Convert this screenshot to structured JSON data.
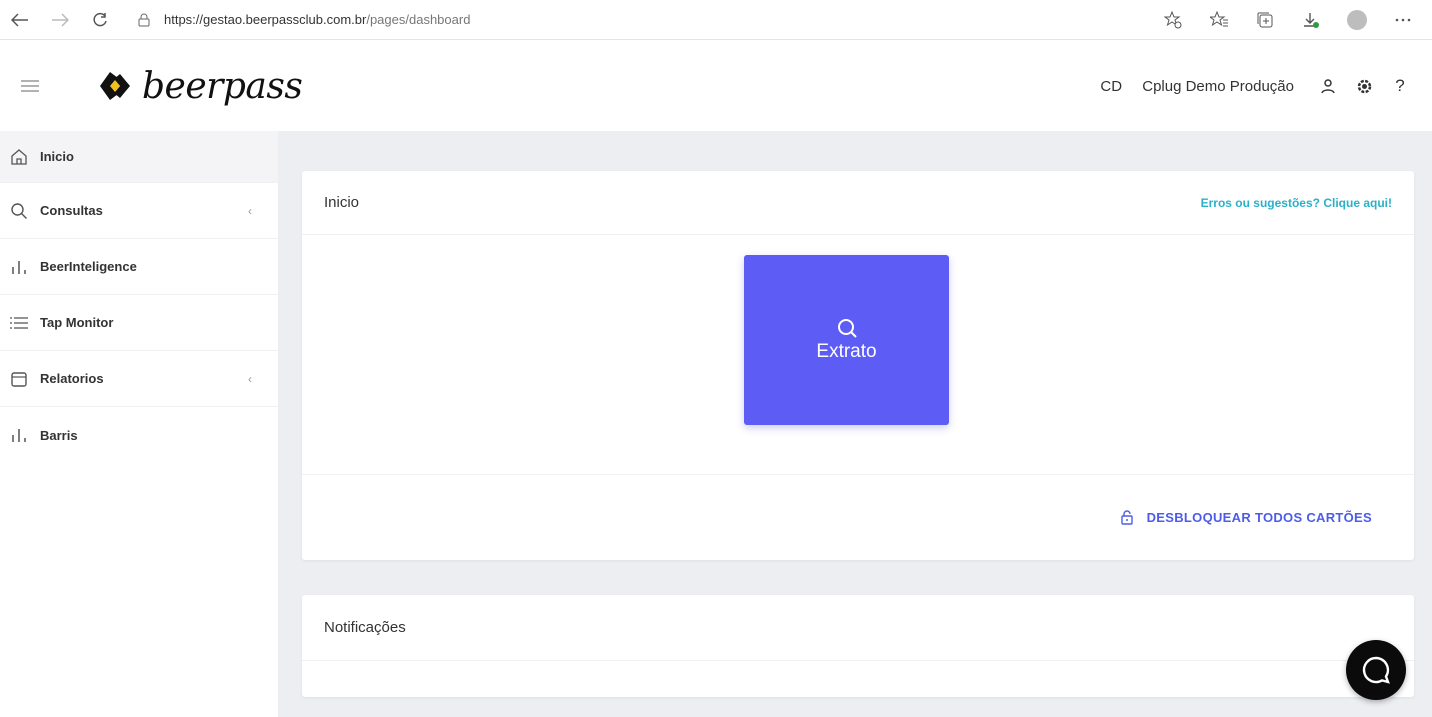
{
  "browser": {
    "url_base": "https://gestao.beerpassclub.com.br",
    "url_path": "/pages/dashboard",
    "icons": [
      "back-arrow-icon",
      "forward-arrow-icon",
      "refresh-icon",
      "lock-icon",
      "star-add-icon",
      "favorites-icon",
      "collections-icon",
      "downloads-icon",
      "profile-icon",
      "more-icon"
    ]
  },
  "header": {
    "logo_text": "beerpass",
    "user_initials": "CD",
    "user_name": "Cplug Demo Produção",
    "help_label": "?"
  },
  "sidebar": {
    "items": [
      {
        "label": "Inicio",
        "icon": "home-icon",
        "has_submenu": false
      },
      {
        "label": "Consultas",
        "icon": "search-icon",
        "has_submenu": true
      },
      {
        "label": "BeerInteligence",
        "icon": "bar-chart-icon",
        "has_submenu": false
      },
      {
        "label": "Tap Monitor",
        "icon": "list-icon",
        "has_submenu": false
      },
      {
        "label": "Relatorios",
        "icon": "folder-icon",
        "has_submenu": true
      },
      {
        "label": "Barris",
        "icon": "bar-chart-icon",
        "has_submenu": false
      }
    ],
    "chevron": "‹"
  },
  "main": {
    "card_inicio": {
      "title": "Inicio",
      "feedback_link": "Erros ou sugestões? Clique aqui!",
      "extrato_label": "Extrato",
      "unlock_label": "DESBLOQUEAR TODOS CARTÕES"
    },
    "card_notificacoes": {
      "title": "Notificações"
    }
  },
  "colors": {
    "accent": "#5d5cf5",
    "link": "#2bb0c8",
    "unlock": "#4d5ce8",
    "background": "#eceef2"
  }
}
